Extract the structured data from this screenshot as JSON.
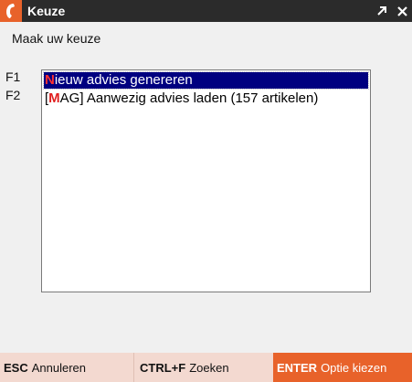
{
  "window": {
    "title": "Keuze",
    "app_icon": "phone-handset-icon",
    "buttons": [
      "maximize-icon",
      "close-icon"
    ]
  },
  "prompt": "Maak uw keuze",
  "fkeys": [
    "F1",
    "F2"
  ],
  "list": {
    "items": [
      {
        "prefix": "",
        "hotkey": "N",
        "rest": "ieuw advies genereren",
        "selected": true
      },
      {
        "prefix": "[",
        "hotkey": "M",
        "rest": "AG] Aanwezig advies laden (157 artikelen)",
        "selected": false
      }
    ]
  },
  "footer": {
    "esc": {
      "key": "ESC",
      "label": "Annuleren"
    },
    "search": {
      "key": "CTRL+F",
      "label": "Zoeken"
    },
    "enter": {
      "key": "ENTER",
      "label": "Optie kiezen"
    }
  },
  "colors": {
    "titlebar": "#2b2b2b",
    "accent": "#e8622a",
    "selection": "#000080",
    "hotkey": "#e02020",
    "footer_button": "#f3d9d0"
  }
}
